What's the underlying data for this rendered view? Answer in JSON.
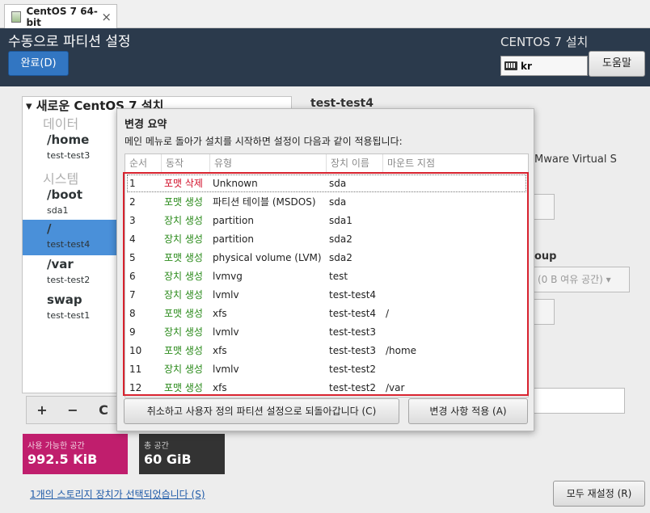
{
  "vm": {
    "tab_title": "CentOS 7 64-bit",
    "close": "×"
  },
  "header": {
    "title": "수동으로 파티션 설정",
    "done_label": "완료(D)",
    "product": "CENTOS 7 설치",
    "keyboard_layout": "kr",
    "help_label": "도움말"
  },
  "left_panel": {
    "title": "▾ 새로운 CentOS 7 설치",
    "section_data": "데이터",
    "section_system": "시스템",
    "mounts": [
      {
        "name": "/home",
        "device": "test-test3"
      },
      {
        "name": "/boot",
        "device": "sda1"
      },
      {
        "name": "/",
        "device": "test-test4"
      },
      {
        "name": "/var",
        "device": "test-test2"
      },
      {
        "name": "swap",
        "device": "test-test1"
      }
    ],
    "tools": {
      "add": "+",
      "remove": "−",
      "refresh": "C"
    }
  },
  "right_panel": {
    "title": "test-test4",
    "device_text": "Mware Virtual S",
    "group_label": "oup",
    "group_combo": "(0 B 여유 공간) ▾"
  },
  "space": {
    "available_label": "사용 가능한 공간",
    "available_value": "992.5 KiB",
    "total_label": "총 공간",
    "total_value": "60 GiB"
  },
  "storage_link": "1개의 스토리지 장치가 선택되었습니다 (S)",
  "reset_label": "모두 재설정 (R)",
  "dialog": {
    "title": "변경 요약",
    "message": "메인 메뉴로 돌아가 설치를 시작하면 설정이 다음과 같이 적용됩니다:",
    "columns": [
      "순서",
      "동작",
      "유형",
      "장치 이름",
      "마운트 지점"
    ],
    "rows": [
      {
        "order": "1",
        "action": "포맷 삭제",
        "type": "Unknown",
        "device": "sda",
        "mount": "",
        "action_kind": "destroy"
      },
      {
        "order": "2",
        "action": "포맷 생성",
        "type": "파티션 테이블 (MSDOS)",
        "device": "sda",
        "mount": "",
        "action_kind": "create"
      },
      {
        "order": "3",
        "action": "장치 생성",
        "type": "partition",
        "device": "sda1",
        "mount": "",
        "action_kind": "create"
      },
      {
        "order": "4",
        "action": "장치 생성",
        "type": "partition",
        "device": "sda2",
        "mount": "",
        "action_kind": "create"
      },
      {
        "order": "5",
        "action": "포맷 생성",
        "type": "physical volume (LVM)",
        "device": "sda2",
        "mount": "",
        "action_kind": "create"
      },
      {
        "order": "6",
        "action": "장치 생성",
        "type": "lvmvg",
        "device": "test",
        "mount": "",
        "action_kind": "create"
      },
      {
        "order": "7",
        "action": "장치 생성",
        "type": "lvmlv",
        "device": "test-test4",
        "mount": "",
        "action_kind": "create"
      },
      {
        "order": "8",
        "action": "포맷 생성",
        "type": "xfs",
        "device": "test-test4",
        "mount": "/",
        "action_kind": "create"
      },
      {
        "order": "9",
        "action": "장치 생성",
        "type": "lvmlv",
        "device": "test-test3",
        "mount": "",
        "action_kind": "create"
      },
      {
        "order": "10",
        "action": "포맷 생성",
        "type": "xfs",
        "device": "test-test3",
        "mount": "/home",
        "action_kind": "create"
      },
      {
        "order": "11",
        "action": "장치 생성",
        "type": "lvmlv",
        "device": "test-test2",
        "mount": "",
        "action_kind": "create"
      },
      {
        "order": "12",
        "action": "포맷 생성",
        "type": "xfs",
        "device": "test-test2",
        "mount": "/var",
        "action_kind": "create"
      }
    ],
    "cancel_label": "취소하고 사용자 정의 파티션 설정으로 되돌아갑니다 (C)",
    "accept_label": "변경 사항 적용 (A)"
  },
  "colors": {
    "header_bg": "#2b3a4c",
    "accent_blue": "#3276c2",
    "destroy_red": "#d2102a",
    "create_green": "#2a8a1a",
    "available_bg": "#c01e6d",
    "highlight_border": "#d7222e"
  }
}
